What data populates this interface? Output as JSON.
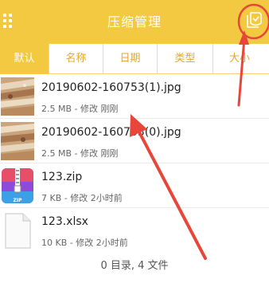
{
  "header": {
    "title": "压缩管理",
    "menu_icon": "grid-menu-icon",
    "select_icon": "shield-check-icon",
    "bg_color": "#f2c940"
  },
  "tabs": [
    {
      "label": "默认",
      "active": true
    },
    {
      "label": "名称",
      "active": false
    },
    {
      "label": "日期",
      "active": false
    },
    {
      "label": "类型",
      "active": false
    },
    {
      "label": "大小",
      "active": false
    }
  ],
  "files": [
    {
      "name": "20190602-160753(1).jpg",
      "meta": "2.5 MB - 修改 刚刚",
      "icon": "image-thumbnail"
    },
    {
      "name": "20190602-160753(0).jpg",
      "meta": "2.5 MB - 修改 刚刚",
      "icon": "image-thumbnail"
    },
    {
      "name": "123.zip",
      "meta": "7 KB - 修改 2小时前",
      "icon": "zip-file-icon"
    },
    {
      "name": "123.xlsx",
      "meta": "10 KB - 修改 2小时前",
      "icon": "document-file-icon"
    }
  ],
  "footer": {
    "summary": "0 目录, 4 文件"
  },
  "annotation": {
    "color": "#e8463a"
  }
}
